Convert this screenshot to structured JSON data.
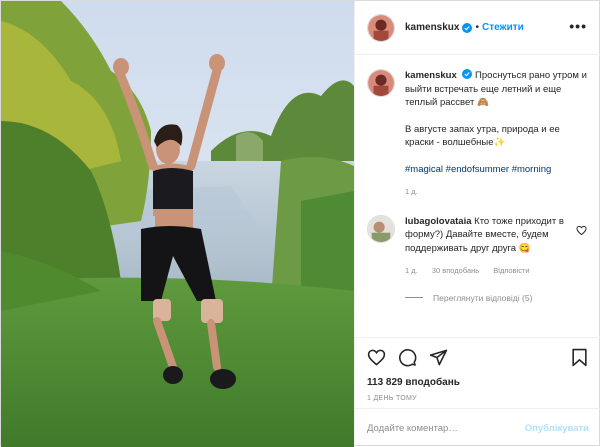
{
  "post": {
    "author": "kamenskux",
    "follow_label": "Стежити",
    "more_label": "•••",
    "caption": {
      "line1": "Проснуться рано утром и выйти встречать еще летний и еще теплый рассвет 🙈",
      "line2": "В августе запах утра, природа и ее краски - волшебные✨",
      "tags": [
        "#magical",
        "#endofsummer",
        "#morning"
      ],
      "time": "1 д."
    },
    "comment": {
      "user": "lubagolovataia",
      "text": "Кто тоже приходит в форму?) Давайте вместе, будем поддерживать друг друга 😋",
      "time": "1 д.",
      "likes": "30 вподобань",
      "reply_label": "Відповісти",
      "view_replies": "Переглянути відповіді (5)"
    },
    "likes_count": "113 829 вподобань",
    "posted_ago": "1 ДЕНЬ ТОМУ",
    "add_comment_placeholder": "Додайте коментар…",
    "publish_label": "Опублікувати"
  },
  "colors": {
    "link_blue": "#0095f6",
    "hashtag": "#00376b",
    "muted": "#8e8e8e",
    "publish_disabled": "#b2dffc"
  },
  "icons": [
    "verified-icon",
    "more-options-icon",
    "heart-icon",
    "comment-icon",
    "share-icon",
    "bookmark-icon",
    "comment-like-icon"
  ]
}
